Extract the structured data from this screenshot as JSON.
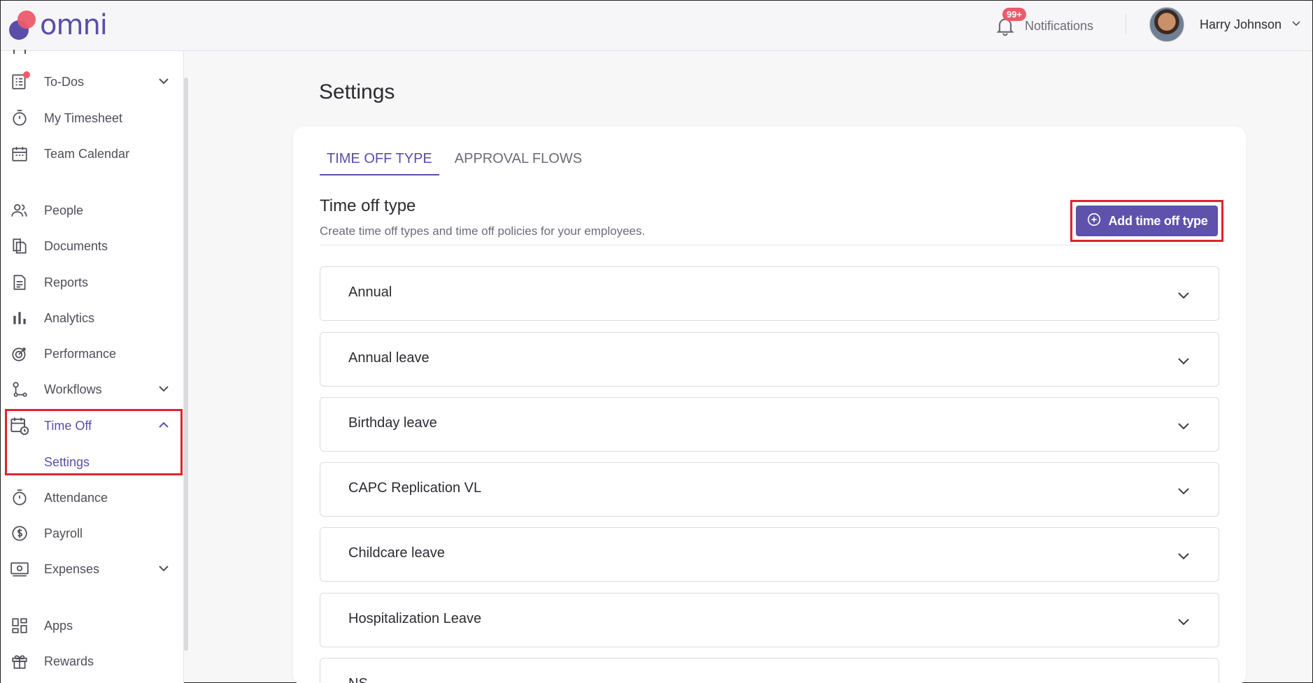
{
  "app": {
    "logo_text": "omni"
  },
  "header": {
    "notifications_badge": "99+",
    "notifications_label": "Notifications",
    "user_name": "Harry Johnson"
  },
  "sidebar": {
    "items": [
      {
        "label": "To-Dos",
        "icon": "todo-list-icon"
      },
      {
        "label": "My Timesheet",
        "icon": "stopwatch-icon"
      },
      {
        "label": "Team Calendar",
        "icon": "calendar-icon"
      },
      {
        "label": "People",
        "icon": "people-icon"
      },
      {
        "label": "Documents",
        "icon": "documents-icon"
      },
      {
        "label": "Reports",
        "icon": "report-icon"
      },
      {
        "label": "Analytics",
        "icon": "bar-chart-icon"
      },
      {
        "label": "Performance",
        "icon": "target-icon"
      },
      {
        "label": "Workflows",
        "icon": "workflow-icon"
      },
      {
        "label": "Time Off",
        "icon": "calendar-clock-icon"
      },
      {
        "label": "Attendance",
        "icon": "stopwatch-icon"
      },
      {
        "label": "Payroll",
        "icon": "dollar-icon"
      },
      {
        "label": "Expenses",
        "icon": "money-icon"
      },
      {
        "label": "Apps",
        "icon": "apps-grid-icon"
      },
      {
        "label": "Rewards",
        "icon": "gift-icon"
      }
    ],
    "time_off_sub": "Settings"
  },
  "main": {
    "page_title": "Settings",
    "tabs": [
      {
        "label": "TIME OFF TYPE"
      },
      {
        "label": "APPROVAL FLOWS"
      }
    ],
    "section_title": "Time off type",
    "section_subtitle": "Create time off types and time off policies for your employees.",
    "add_button_label": "Add time off type",
    "time_off_types": [
      "Annual",
      "Annual leave",
      "Birthday leave",
      "CAPC Replication VL",
      "Childcare leave",
      "Hospitalization Leave",
      "NS"
    ]
  },
  "colors": {
    "accent": "#5a4ea8",
    "highlight": "#e0232e",
    "badge": "#ee5a6a"
  }
}
